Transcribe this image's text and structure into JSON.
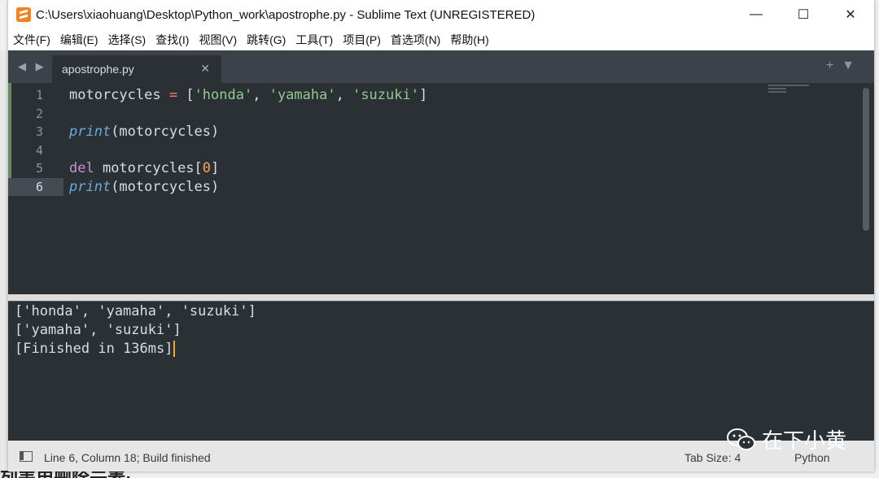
{
  "window": {
    "title": "C:\\Users\\xiaohuang\\Desktop\\Python_work\\apostrophe.py - Sublime Text (UNREGISTERED)",
    "controls": {
      "minimize": "—",
      "maximize": "☐",
      "close": "✕"
    }
  },
  "menu": [
    "文件(F)",
    "编辑(E)",
    "选择(S)",
    "查找(I)",
    "视图(V)",
    "跳转(G)",
    "工具(T)",
    "项目(P)",
    "首选项(N)",
    "帮助(H)"
  ],
  "tabs": {
    "active": "apostrophe.py",
    "close": "✕",
    "nav": "◀ ▶",
    "add": "+",
    "dropdown": "▼"
  },
  "editor": {
    "active_line": 6,
    "lines": [
      {
        "num": "1",
        "tokens": [
          {
            "t": "motorcycles ",
            "c": "plain"
          },
          {
            "t": "=",
            "c": "op"
          },
          {
            "t": " [",
            "c": "plain"
          },
          {
            "t": "'honda'",
            "c": "str"
          },
          {
            "t": ", ",
            "c": "plain"
          },
          {
            "t": "'yamaha'",
            "c": "str"
          },
          {
            "t": ", ",
            "c": "plain"
          },
          {
            "t": "'suzuki'",
            "c": "str"
          },
          {
            "t": "]",
            "c": "plain"
          }
        ]
      },
      {
        "num": "2",
        "tokens": []
      },
      {
        "num": "3",
        "tokens": [
          {
            "t": "print",
            "c": "fn"
          },
          {
            "t": "(motorcycles)",
            "c": "plain"
          }
        ]
      },
      {
        "num": "4",
        "tokens": []
      },
      {
        "num": "5",
        "tokens": [
          {
            "t": "del",
            "c": "kw"
          },
          {
            "t": " motorcycles[",
            "c": "plain"
          },
          {
            "t": "0",
            "c": "num"
          },
          {
            "t": "]",
            "c": "plain"
          }
        ]
      },
      {
        "num": "6",
        "tokens": [
          {
            "t": "print",
            "c": "fn"
          },
          {
            "t": "(motorcycles)",
            "c": "plain"
          }
        ]
      }
    ]
  },
  "output": {
    "lines": [
      "['honda', 'yamaha', 'suzuki']",
      "['yamaha', 'suzuki']",
      "[Finished in 136ms]"
    ]
  },
  "status": {
    "position": "Line 6, Column 18; Build finished",
    "tab_size": "Tab Size: 4",
    "syntax": "Python"
  },
  "watermark": {
    "text": "在下小黄"
  },
  "background": {
    "peek_text": "列表用删除元素:"
  }
}
